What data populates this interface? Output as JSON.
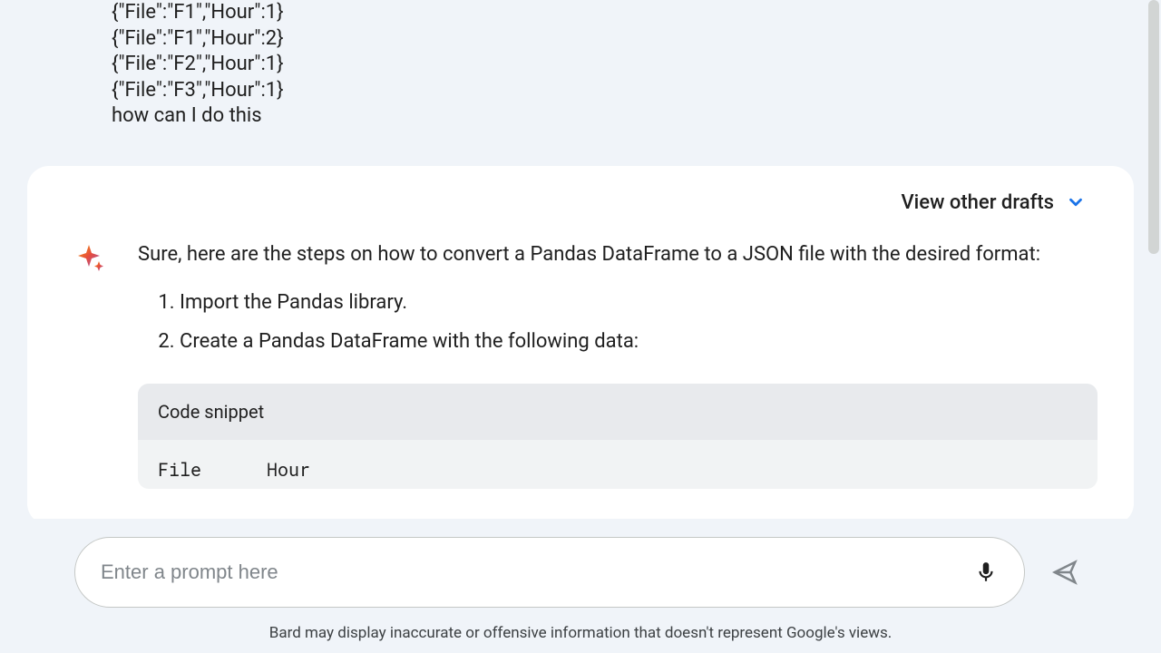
{
  "user_message": {
    "lines": [
      "{\"File\":\"F1\",\"Hour\":1}",
      "{\"File\":\"F1\",\"Hour\":2}",
      "{\"File\":\"F2\",\"Hour\":1}",
      "{\"File\":\"F3\",\"Hour\":1}",
      "",
      "how can I do this"
    ]
  },
  "drafts_button_label": "View other drafts",
  "response": {
    "intro": "Sure, here are the steps on how to convert a Pandas DataFrame to a JSON file with the desired format:",
    "steps": [
      "Import the Pandas library.",
      "Create a Pandas DataFrame with the following data:"
    ],
    "code_header": "Code snippet",
    "code_content": "File      Hour"
  },
  "input": {
    "placeholder": "Enter a prompt here"
  },
  "disclaimer": "Bard may display inaccurate or offensive information that doesn't represent Google's views."
}
